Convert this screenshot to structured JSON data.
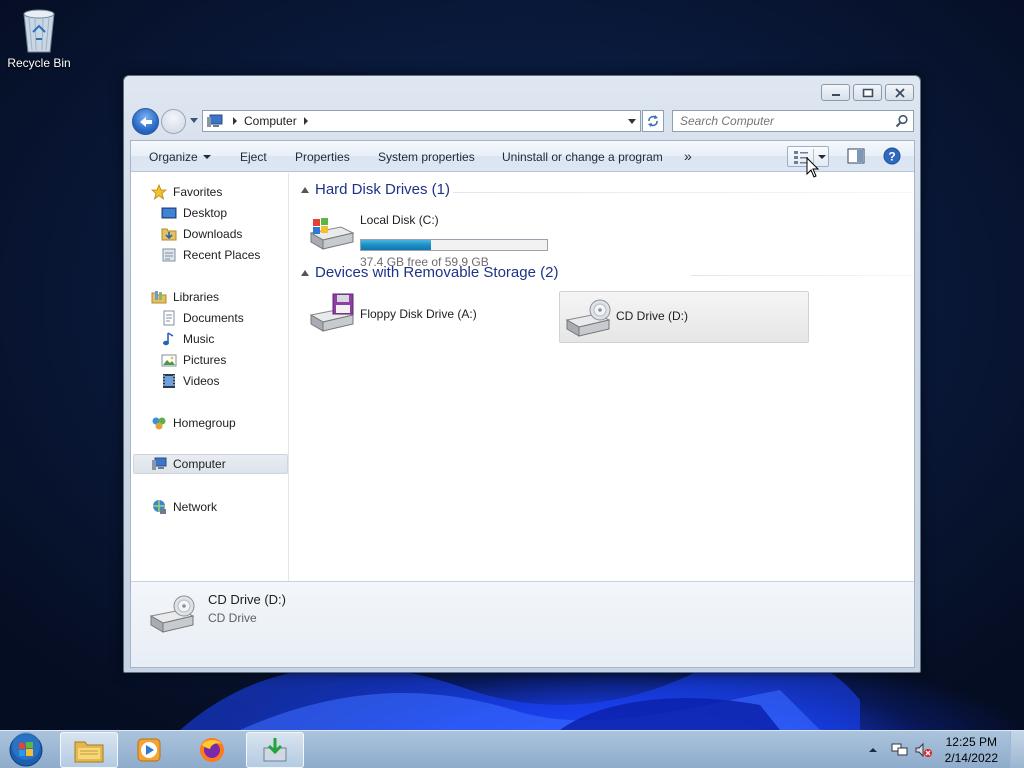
{
  "desktop": {
    "icons": [
      {
        "label": "Recycle Bin",
        "icon": "recycle-bin-icon"
      }
    ]
  },
  "window": {
    "address": {
      "crumbs": [
        "Computer"
      ]
    },
    "search": {
      "placeholder": "Search Computer"
    },
    "toolbar": {
      "organize": "Organize",
      "eject": "Eject",
      "properties": "Properties",
      "system_properties": "System properties",
      "uninstall": "Uninstall or change a program",
      "more": "»"
    },
    "nav": {
      "favorites": {
        "label": "Favorites",
        "items": [
          "Desktop",
          "Downloads",
          "Recent Places"
        ]
      },
      "libraries": {
        "label": "Libraries",
        "items": [
          "Documents",
          "Music",
          "Pictures",
          "Videos"
        ]
      },
      "homegroup": "Homegroup",
      "computer": "Computer",
      "network": "Network"
    },
    "groups": {
      "hdd": {
        "title": "Hard Disk Drives (1)",
        "drives": [
          {
            "name": "Local Disk (C:)",
            "free_text": "37.4 GB free of 59.9 GB",
            "used_fraction": 0.376
          }
        ]
      },
      "removable": {
        "title": "Devices with Removable Storage (2)",
        "drives": [
          {
            "name": "Floppy Disk Drive (A:)"
          },
          {
            "name": "CD Drive (D:)"
          }
        ]
      }
    },
    "details": {
      "name": "CD Drive (D:)",
      "type": "CD Drive"
    }
  },
  "taskbar": {
    "clock": {
      "time": "12:25 PM",
      "date": "2/14/2022"
    },
    "buttons": [
      "explorer-icon",
      "media-player-icon",
      "firefox-icon",
      "installer-icon"
    ]
  },
  "colors": {
    "accent": "#1e3287",
    "capacity_bar": "#1d8fc6"
  }
}
